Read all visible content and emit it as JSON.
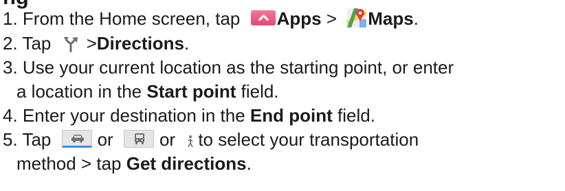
{
  "heading": {
    "partial_title": "ng"
  },
  "steps": {
    "s1": {
      "prefix": "1. From the Home screen, tap",
      "apps": "Apps",
      "sep": ">",
      "maps": "Maps",
      "end": "."
    },
    "s2": {
      "prefix": "2. Tap",
      "sep": ">",
      "directions": "Directions",
      "end": "."
    },
    "s3": {
      "line1": "3. Use your current location as the starting point, or enter",
      "line2_a": "a location in the",
      "start_point": "Start point",
      "line2_b": "field."
    },
    "s4": {
      "a": "4. Enter your destination in the",
      "end_point": "End point",
      "b": "field."
    },
    "s5": {
      "prefix": "5. Tap",
      "or1": "or",
      "or2": "or",
      "suffix": "to select your transportation",
      "line2_a": "method > tap",
      "get_directions": "Get directions",
      "end": "."
    }
  },
  "icons": {
    "apps": "apps-icon",
    "maps": "maps-icon",
    "directions": "directions-icon",
    "car": "car-icon",
    "transit": "transit-icon",
    "walk": "walk-icon",
    "apps_color": "#e24b73",
    "selected_underline": "#3a8fd9"
  }
}
